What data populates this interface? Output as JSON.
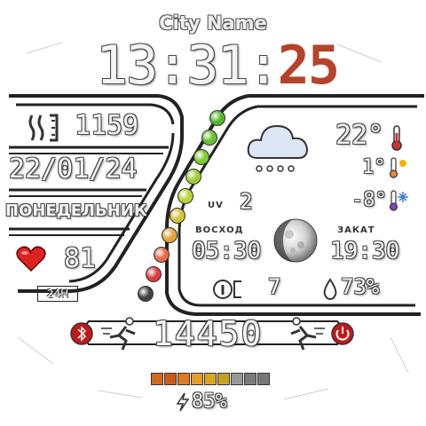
{
  "city": "City Name",
  "time": {
    "hours": "13",
    "minutes": "31",
    "seconds": "25",
    "sep": ":"
  },
  "left": {
    "steps": "1159",
    "date": "22/01/24",
    "weekday": "ПОНЕДЕЛЬНИК",
    "heart_rate": "81",
    "format": "24H"
  },
  "weather": {
    "temp": "22°",
    "temp_max": "1°",
    "temp_min": "-8°",
    "uv_label": "UV",
    "uv_value": "2",
    "sunrise_label": "ВОСХОД",
    "sunrise": "05:30",
    "sunset_label": "ЗАКАТ",
    "sunset": "19:30",
    "notifications": "7",
    "humidity": "73%"
  },
  "bottom": {
    "steps": "14450",
    "battery": "85%",
    "battery_level": 0.85,
    "battery_segment_colors": [
      "#d2691e",
      "#cd5c1a",
      "#e07b22",
      "#e89a2a",
      "#d8a61f",
      "#c8a020",
      "#999999",
      "#7a7a7a",
      "#777777"
    ]
  },
  "colors": {
    "seconds": "#b5422a",
    "frame": "#222222",
    "dots": [
      "#55b52a",
      "#68c02d",
      "#7ccb32",
      "#9acd32",
      "#b8d43a",
      "#d4c23b",
      "#e6a23a",
      "#e66a4a",
      "#e03b3b",
      "#444444"
    ]
  },
  "icons": {
    "steps": "steps-icon",
    "heart": "heart-icon",
    "cloud": "cloud-snow-icon",
    "thermometer": "thermometer-icon",
    "moon": "moon-icon",
    "humidity": "drop-icon",
    "runner_left": "runner-icon",
    "runner_right": "runner-icon",
    "bluetooth": "bluetooth-icon",
    "power": "power-icon",
    "battery": "lightning-icon"
  }
}
